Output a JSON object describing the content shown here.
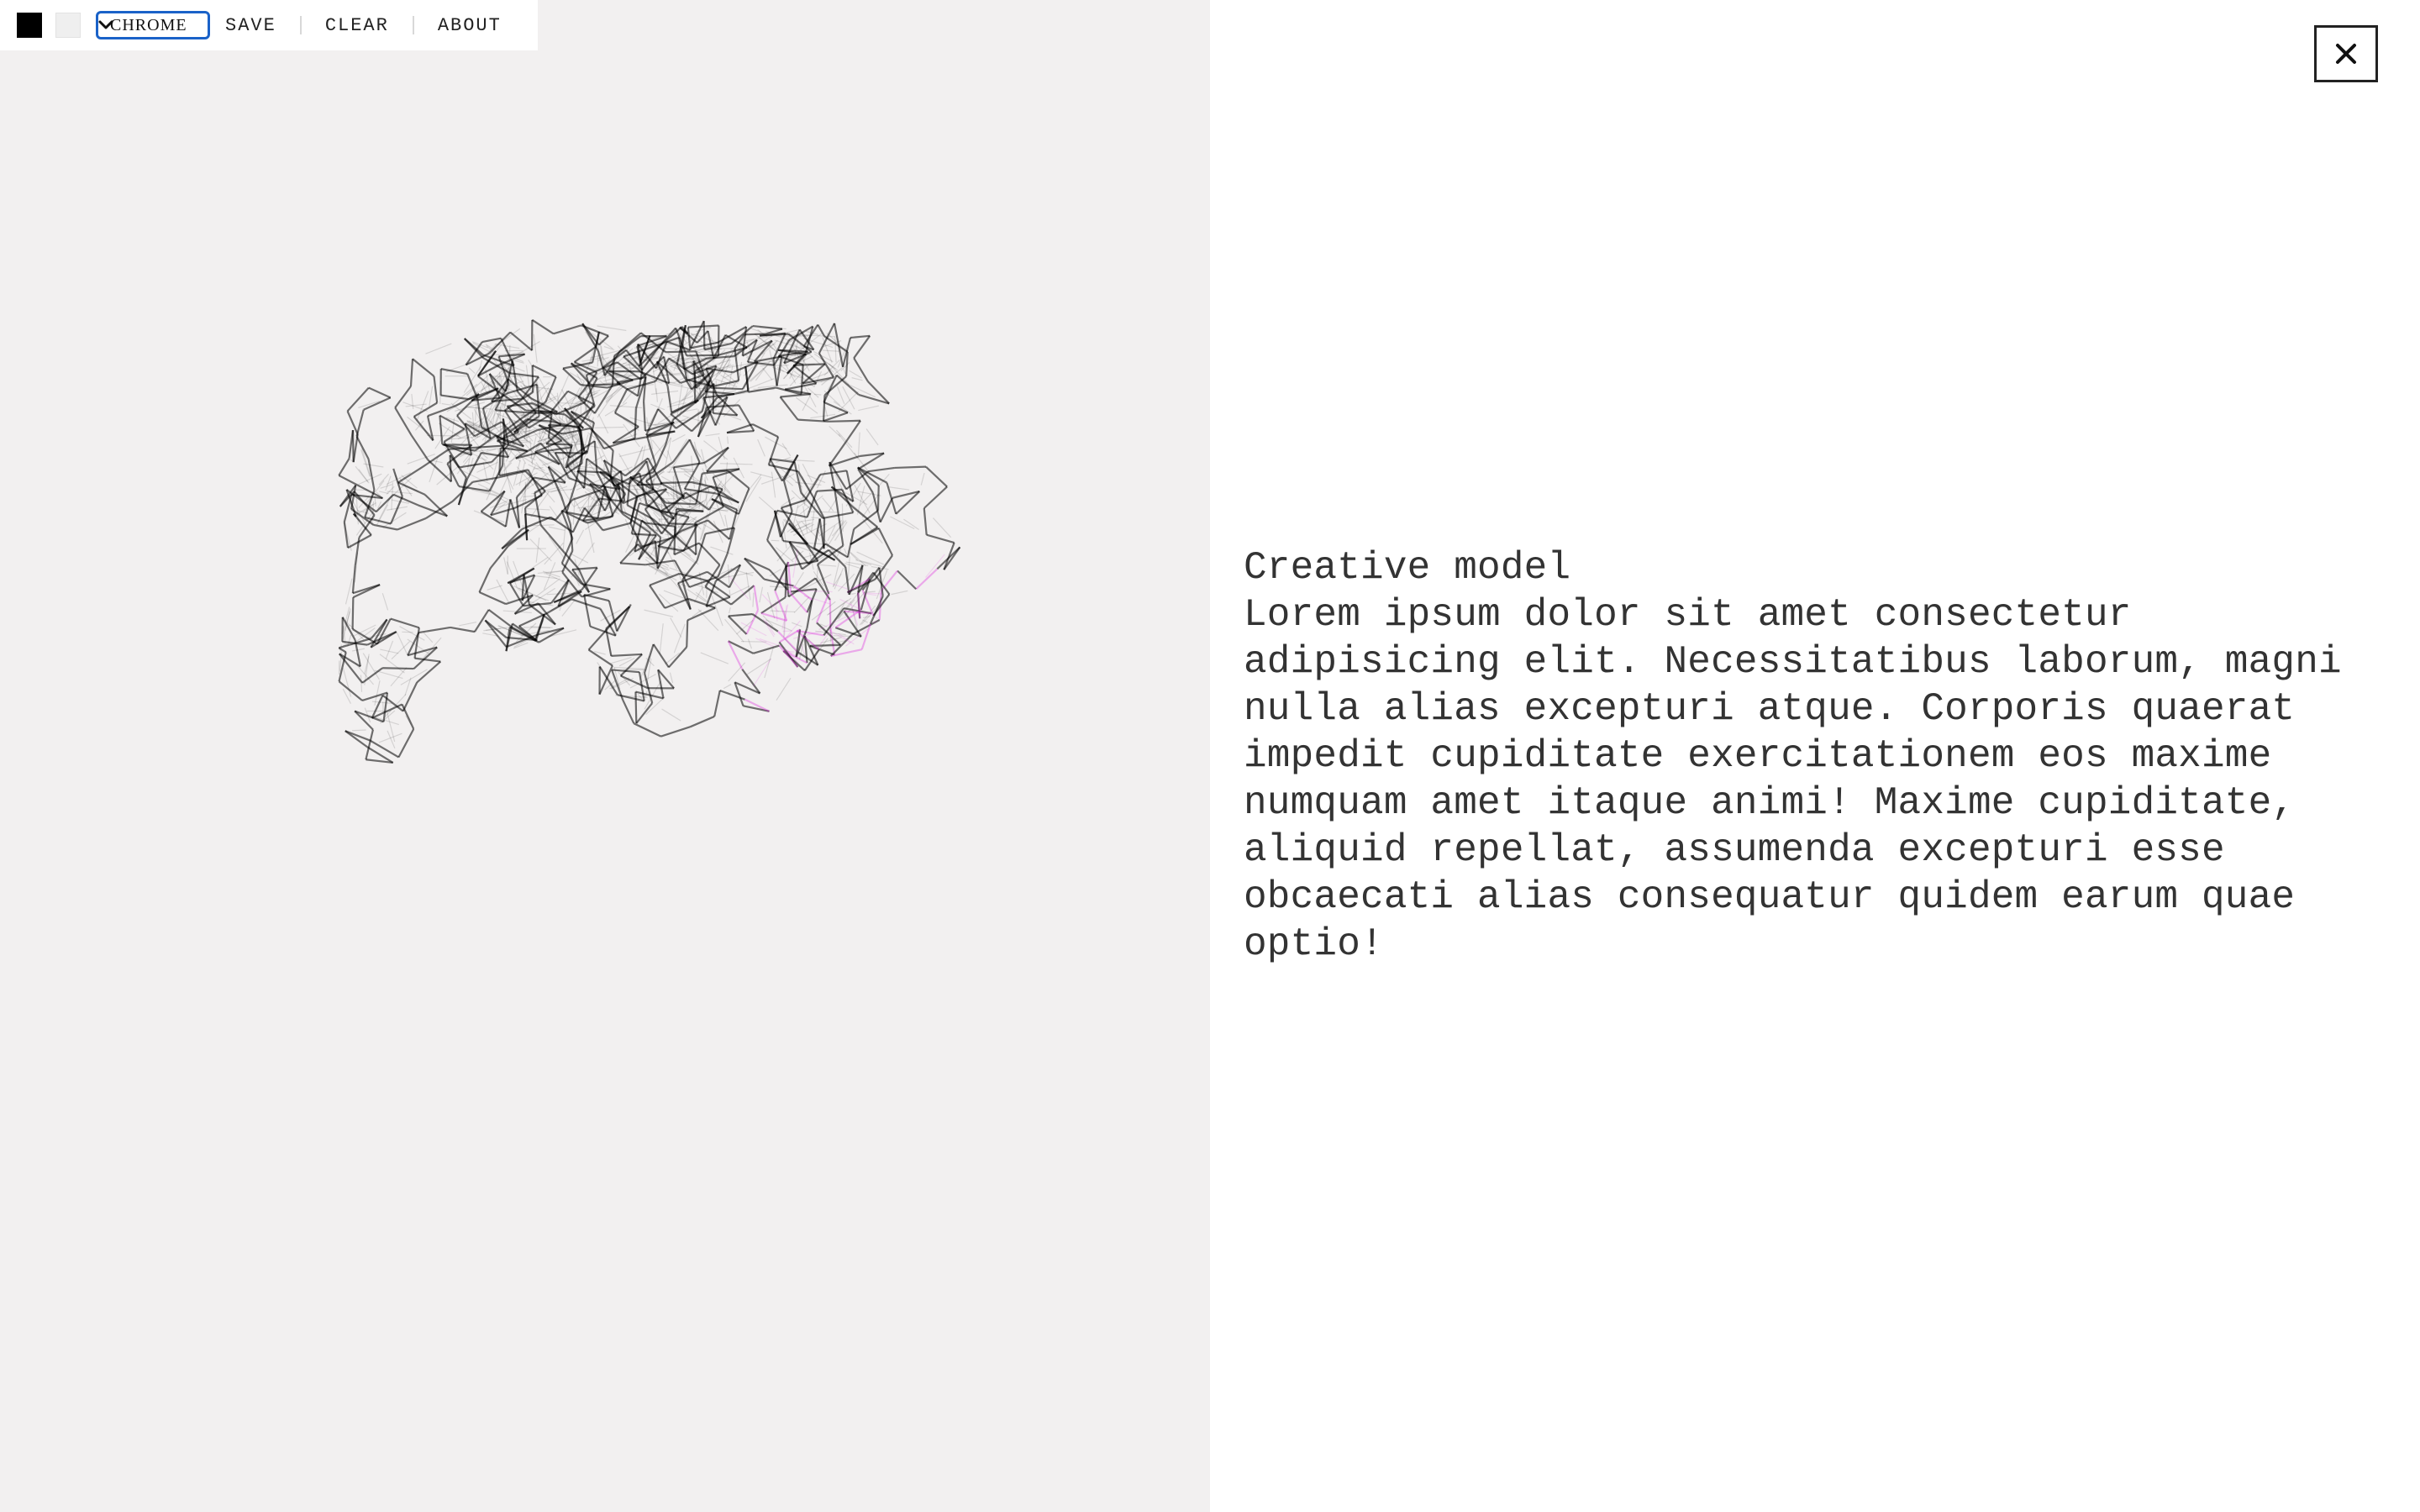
{
  "toolbar": {
    "foreground_color": "#000000",
    "background_color": "#efefef",
    "brush_select": {
      "selected": "CHROME"
    },
    "save_label": "SAVE",
    "clear_label": "CLEAR",
    "about_label": "ABOUT"
  },
  "canvas": {
    "background": "#f2f0f0",
    "stroke_colors": [
      "#000000",
      "#22dd22",
      "#dd22dd",
      "#e8e860"
    ]
  },
  "info": {
    "title": "Creative model",
    "body": "Lorem ipsum dolor sit amet consectetur adipisicing elit. Necessitatibus laborum, magni nulla alias excepturi atque. Corporis quaerat impedit cupiditate exercitationem eos maxime numquam amet itaque animi! Maxime cupiditate, aliquid repellat, assumenda excepturi esse obcaecati alias consequatur quidem earum quae optio!",
    "close_icon": "close-icon"
  }
}
